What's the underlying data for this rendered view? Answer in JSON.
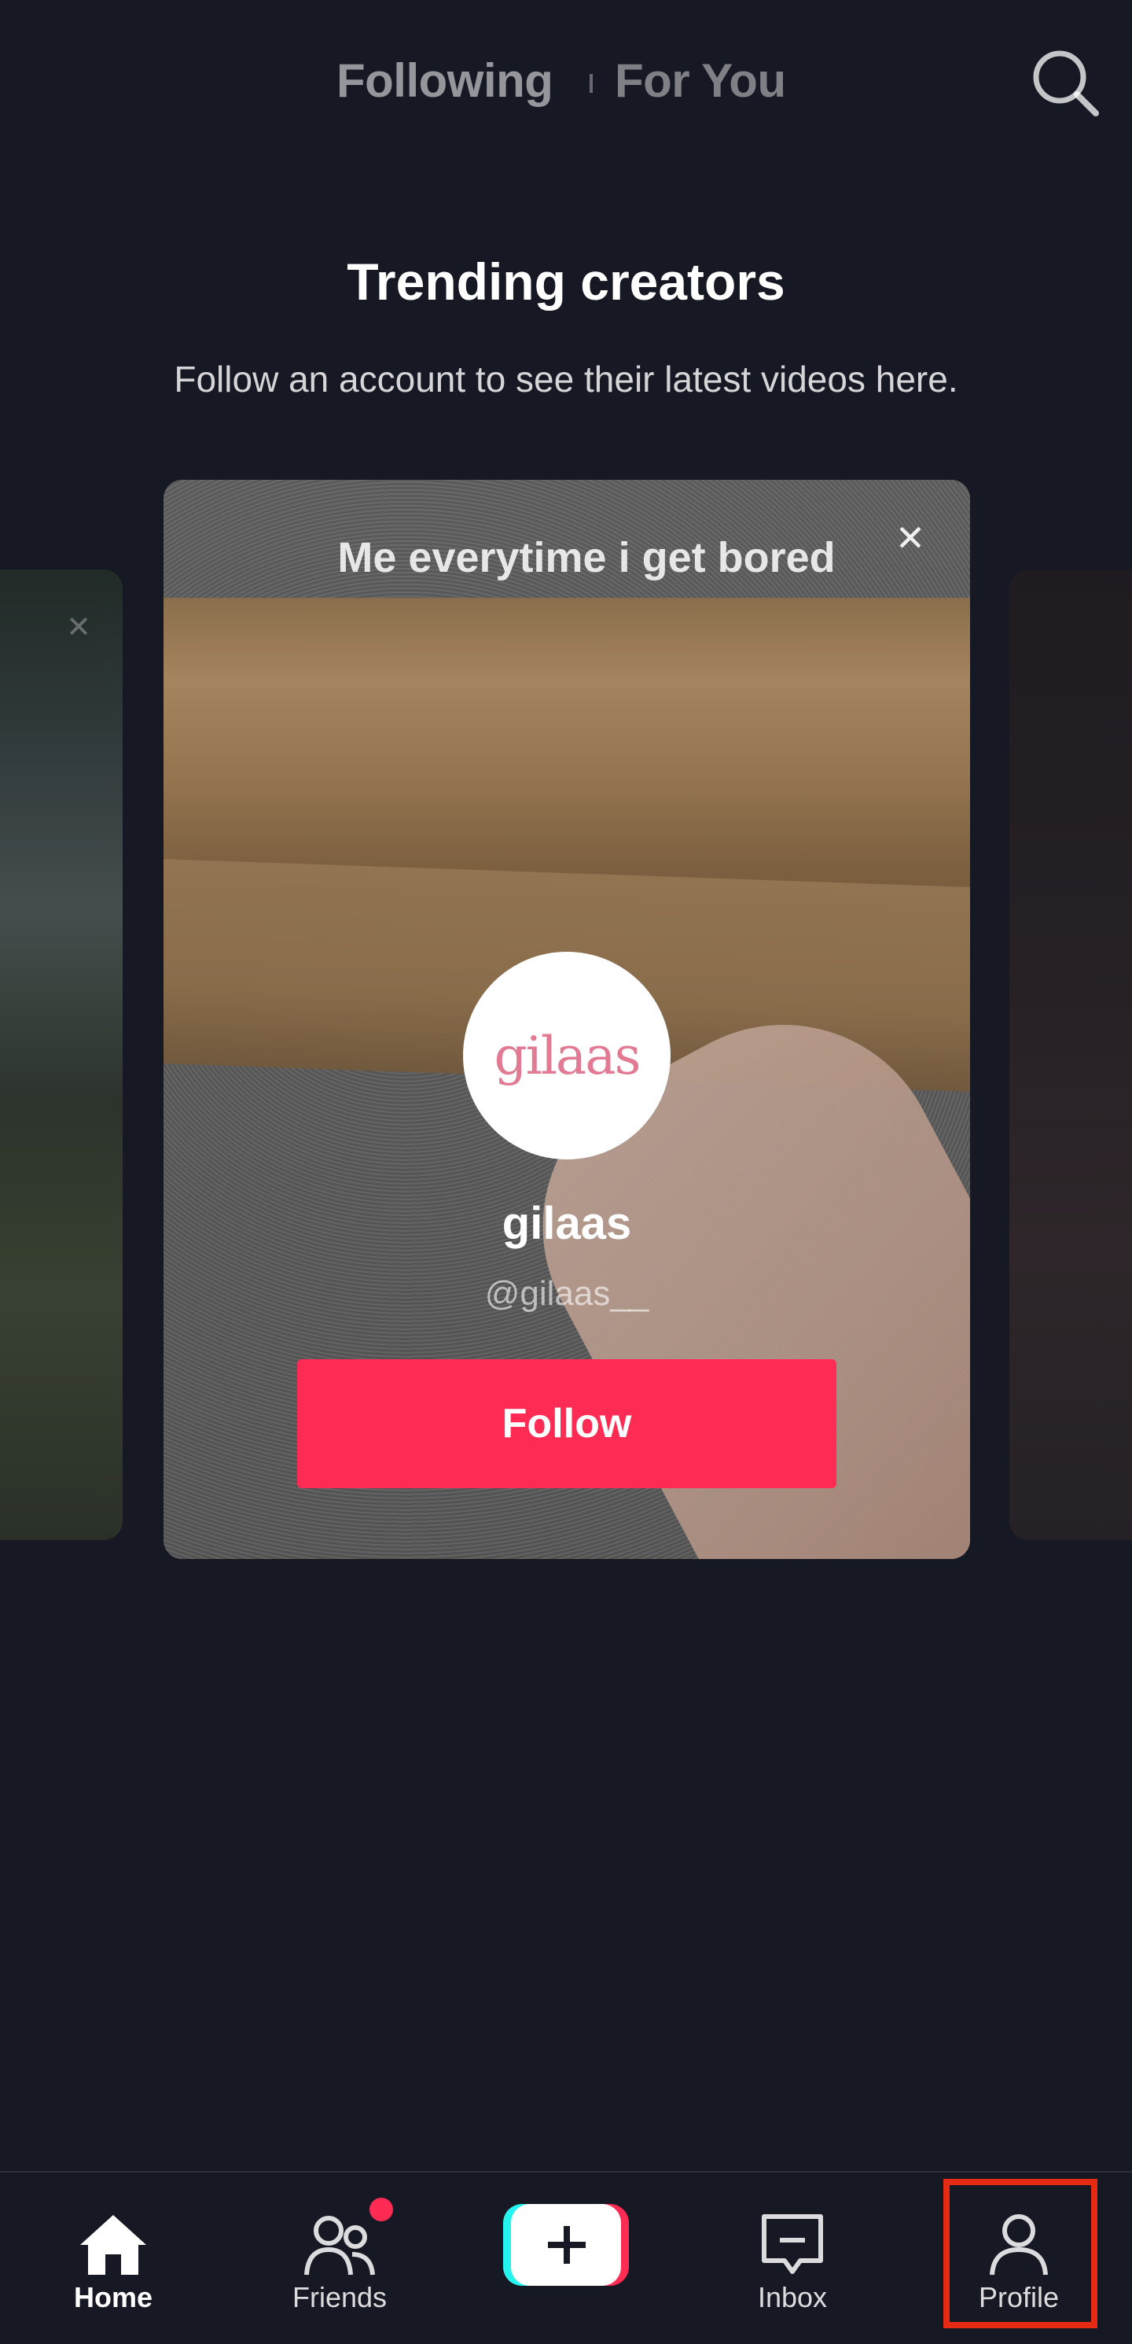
{
  "header": {
    "tab_following": "Following",
    "tab_for_you": "For You",
    "search_icon": "search-icon"
  },
  "main": {
    "title": "Trending creators",
    "subtitle": "Follow an account to see their latest videos here.",
    "card": {
      "video_caption": "Me everytime i get bored",
      "avatar_text": "gilaas",
      "creator_name": "gilaas",
      "creator_handle": "@gilaas__",
      "follow_label": "Follow",
      "close_symbol": "✕"
    },
    "left_card_close_symbol": "✕"
  },
  "bottom_nav": {
    "home": "Home",
    "friends": "Friends",
    "inbox": "Inbox",
    "profile": "Profile",
    "friends_badge_color": "#fe2c55",
    "highlight_color": "#e52b14"
  },
  "colors": {
    "background": "#161823",
    "accent": "#fe2c55"
  }
}
